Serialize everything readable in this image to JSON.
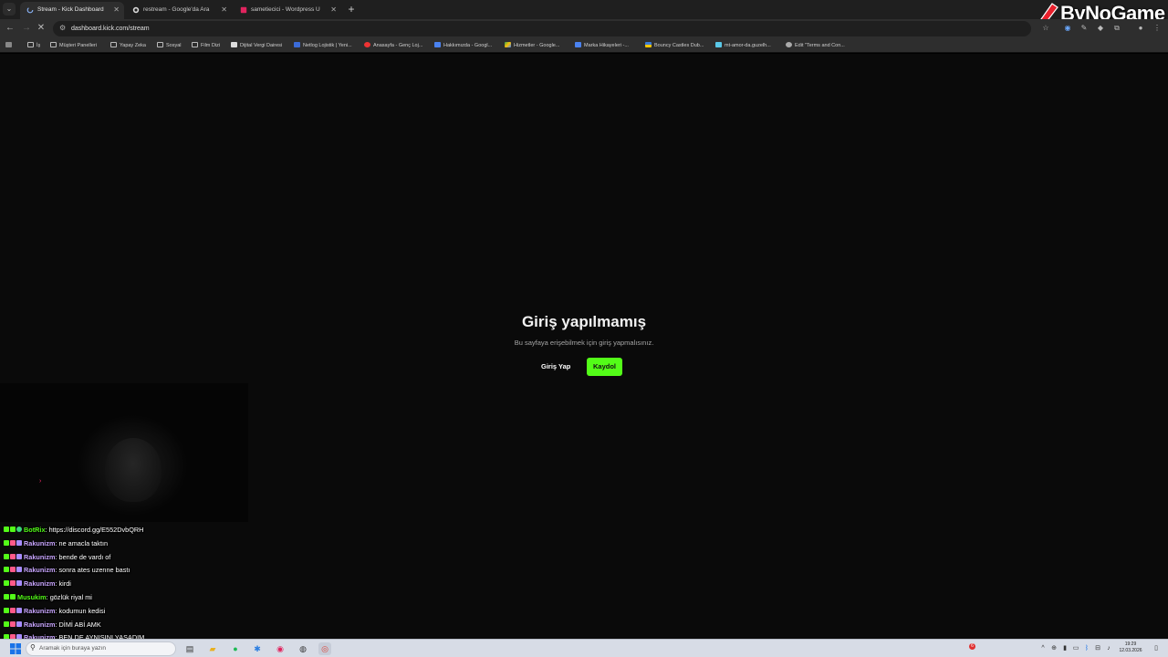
{
  "browser": {
    "tabs": [
      {
        "title": "Stream - Kick Dashboard",
        "favicon": "loading-icon",
        "active": true
      },
      {
        "title": "restream - Google'da Ara",
        "favicon": "google-icon",
        "active": false
      },
      {
        "title": "sametiecici - Wordpress Uzma",
        "favicon": "fiverr-icon",
        "active": false
      }
    ],
    "url": "dashboard.kick.com/stream",
    "bookmarks": [
      {
        "label": "İş",
        "icon": "folder-icon"
      },
      {
        "label": "Müşteri Panelleri",
        "icon": "folder-icon"
      },
      {
        "label": "Yapay Zeka",
        "icon": "folder-icon"
      },
      {
        "label": "Sosyal",
        "icon": "folder-icon"
      },
      {
        "label": "Film Dizi",
        "icon": "folder-icon"
      },
      {
        "label": "Dijital Vergi Dairesi",
        "icon": "tax-office-icon"
      },
      {
        "label": "Netlog Lojistik | Yeni...",
        "icon": "netlog-icon"
      },
      {
        "label": "Anasayfa - Genç Loj...",
        "icon": "site-icon"
      },
      {
        "label": "Hakkımızda - Googl...",
        "icon": "google-docs-icon"
      },
      {
        "label": "Hizmetler - Google...",
        "icon": "google-drive-icon"
      },
      {
        "label": "Marka Hikayeleri -...",
        "icon": "google-docs-icon"
      },
      {
        "label": "Bouncy Castles Dub...",
        "icon": "flag-icon"
      },
      {
        "label": "mt-amor-da.guzelh...",
        "icon": "site-icon"
      },
      {
        "label": "Edit \"Terms and Con...",
        "icon": "wordpress-icon"
      }
    ]
  },
  "overlay_brand": "ByNoGame",
  "page": {
    "title": "Giriş yapılmamış",
    "description": "Bu sayfaya erişebilmek için giriş yapmalısınız.",
    "login_label": "Giriş Yap",
    "signup_label": "Kaydol",
    "accent": "#53fc18"
  },
  "chat": [
    {
      "user": "BotRix",
      "text": "https://discord.gg/E552DvbQRH",
      "user_color": "#53fc18"
    },
    {
      "user": "Rakunizm",
      "text": "ne amacla taktın",
      "user_color": "#c9a6ff"
    },
    {
      "user": "Rakunizm",
      "text": "bende de vardı of",
      "user_color": "#c9a6ff"
    },
    {
      "user": "Rakunizm",
      "text": "sonra ates uzenne bastı",
      "user_color": "#c9a6ff"
    },
    {
      "user": "Rakunizm",
      "text": "kirdi",
      "user_color": "#c9a6ff"
    },
    {
      "user": "Musukim",
      "text": "gözlük riyal mi",
      "user_color": "#53fc18"
    },
    {
      "user": "Rakunizm",
      "text": "kodumun kedisi",
      "user_color": "#c9a6ff"
    },
    {
      "user": "Rakunizm",
      "text": "DİMİ ABİ AMK",
      "user_color": "#c9a6ff"
    },
    {
      "user": "Rakunizm",
      "text": "BEN DE AYNISINI YASADIM",
      "user_color": "#c9a6ff"
    }
  ],
  "taskbar": {
    "search_placeholder": "Aramak için buraya yazın",
    "time": "19:29",
    "date": "12.03.2026",
    "notification_count": "6"
  }
}
